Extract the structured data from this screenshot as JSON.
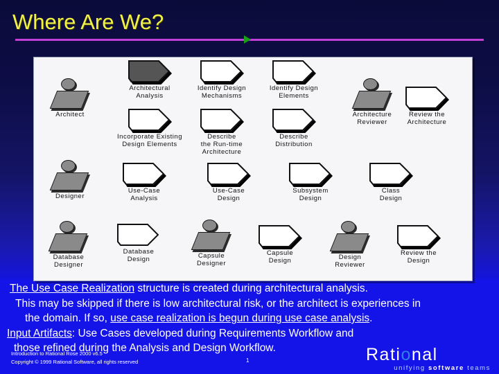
{
  "slide": {
    "title": "Where Are We?",
    "accent_rule_color": "#c13fd6",
    "marker_color": "#17a017",
    "title_color": "#f2f24a",
    "background_top_color": "#0b0b3a",
    "background_bottom_color": "#1414e8"
  },
  "diagram": {
    "rows": [
      {
        "role": {
          "label": "Architect"
        },
        "activities": [
          {
            "label": "Architectural\nAnalysis",
            "highlighted": true
          },
          {
            "label": "Incorporate Existing\nDesign Elements",
            "highlighted": false
          },
          {
            "label": "Identify Design\nMechanisms",
            "highlighted": false
          },
          {
            "label": "Describe\nthe Run-time\nArchitecture",
            "highlighted": false
          },
          {
            "label": "Identify Design\nElements",
            "highlighted": false
          },
          {
            "label": "Describe\nDistribution",
            "highlighted": false
          }
        ],
        "role2": {
          "label": "Architecture\nReviewer"
        },
        "activity2": {
          "label": "Review the\nArchitecture",
          "highlighted": false
        }
      },
      {
        "role": {
          "label": "Designer"
        },
        "activities": [
          {
            "label": "Use-Case\nAnalysis",
            "highlighted": false
          },
          {
            "label": "Use-Case\nDesign",
            "highlighted": false
          },
          {
            "label": "Subsystem\nDesign",
            "highlighted": false
          },
          {
            "label": "Class\nDesign",
            "highlighted": false
          }
        ]
      },
      {
        "role": {
          "label": "Database\nDesigner"
        },
        "activity_a": {
          "label": "Database\nDesign",
          "highlighted": false
        },
        "role_b": {
          "label": "Capsule\nDesigner"
        },
        "activity_b": {
          "label": "Capsule\nDesign",
          "highlighted": false
        },
        "role_c": {
          "label": "Design\nReviewer"
        },
        "activity_c": {
          "label": "Review the\nDesign",
          "highlighted": false
        }
      }
    ]
  },
  "body": {
    "line1_underlined": "The Use Case Realization",
    "line1_rest": " structure is created during architectural analysis.",
    "line2": "This may be skipped if there is low architectural risk, or the architect is experiences in",
    "line3_a": "the domain.  If so, ",
    "line3_underlined": "use case realization is begun during use case analysis",
    "line3_b": ".",
    "line4_underlined": "Input Artifacts",
    "line4_rest": ":  Use Cases developed during Requirements Workflow and",
    "line5": "those refined during the Analysis and Design Workflow."
  },
  "footer": {
    "course": "Introduction to Rational Rose 2000 v6.5",
    "copyright": "Copyright © 1999 Rational Software, all rights reserved",
    "page_number": "1",
    "logo_pre": "Rati",
    "logo_o": "o",
    "logo_post": "nal",
    "logo_tag_1": "unifying ",
    "logo_tag_2": "software ",
    "logo_tag_3": "teams"
  }
}
